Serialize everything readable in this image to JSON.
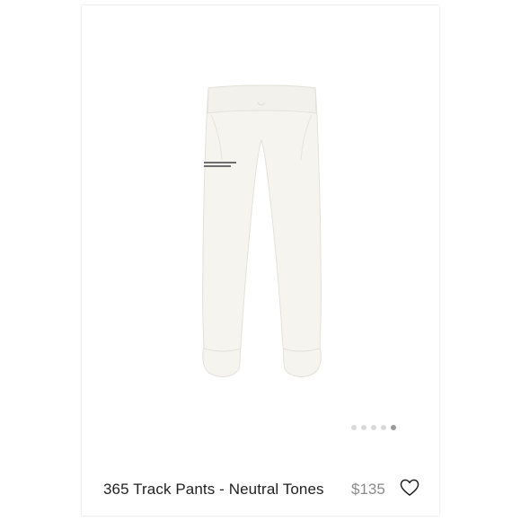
{
  "product": {
    "title": "365 Track Pants - Neutral Tones",
    "price": "$135",
    "image_icon": "track-pants-image",
    "wishlist_icon": "heart-icon"
  },
  "carousel": {
    "total_slides": 5,
    "active_slide": 5
  },
  "colors": {
    "pants_fill": "#f5f4ef",
    "dot_inactive": "#d9d9d9",
    "dot_active": "#9a9a9a",
    "price": "#8a8a8a",
    "title": "#1f1f1f"
  }
}
